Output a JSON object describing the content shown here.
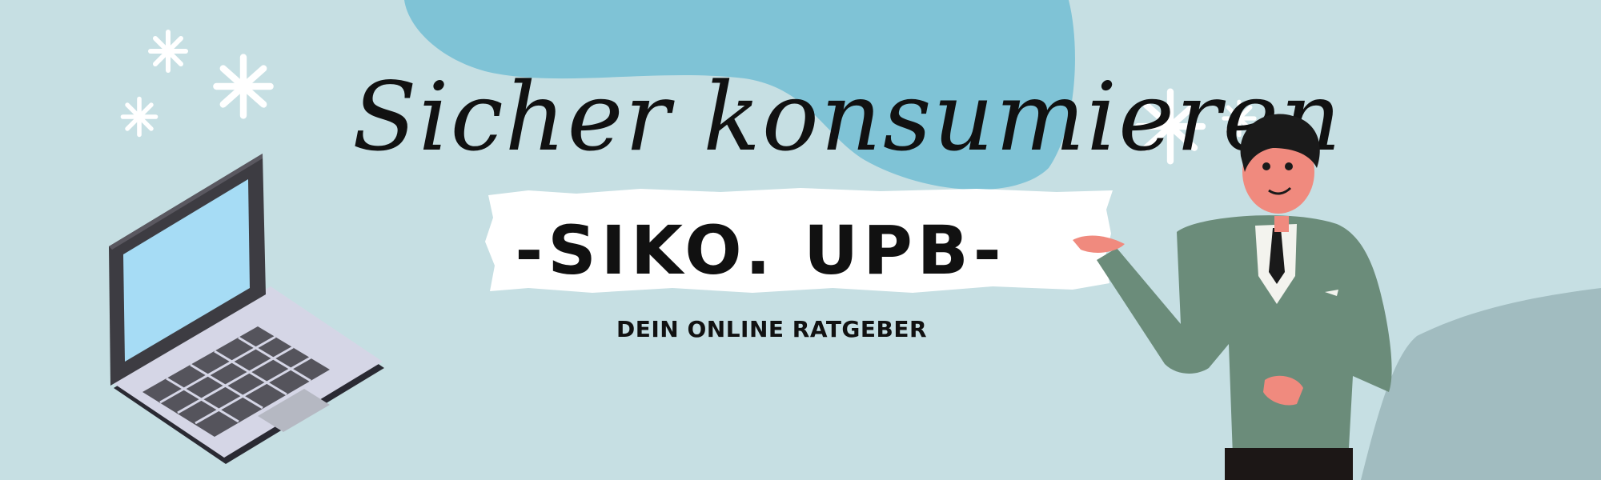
{
  "banner": {
    "script_title": "Sicher konsumieren",
    "main_title": "-SIKO. UPB-",
    "subtitle": "DEIN ONLINE RATGEBER"
  },
  "colors": {
    "background": "#c6dfe3",
    "blob_blue": "#7fc3d6",
    "hill_grey": "#a1bcc0",
    "brush_white": "#ffffff",
    "text_dark": "#111111",
    "jacket_green": "#6b8c7a",
    "skin": "#f08a7e",
    "laptop_screen": "#a6dcf5",
    "laptop_body": "#d5d6e6"
  },
  "icons": [
    "sparkle-icon",
    "laptop-illustration",
    "presenter-illustration"
  ]
}
